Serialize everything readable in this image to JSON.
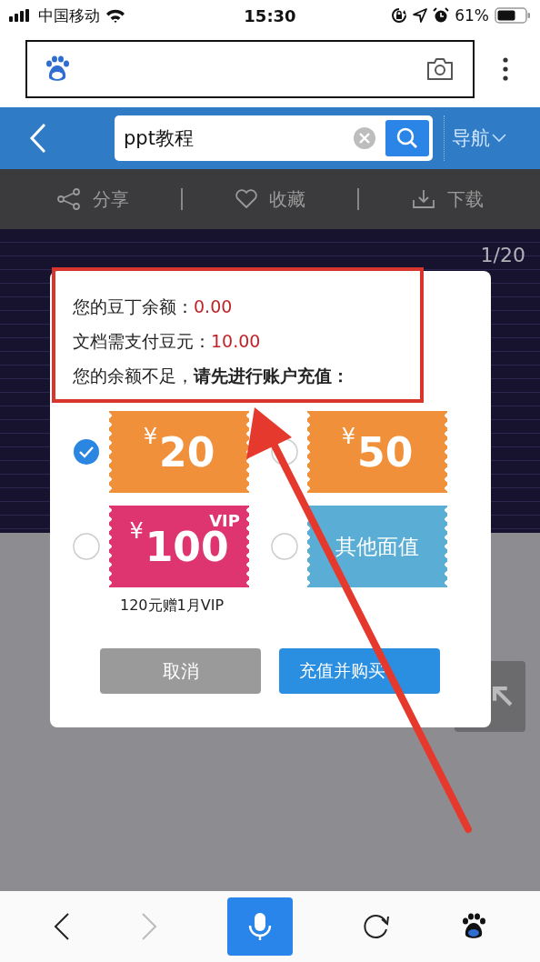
{
  "status_bar": {
    "carrier": "中国移动",
    "time": "15:30",
    "battery": "61%"
  },
  "search_bar": {
    "value": "ppt教程",
    "nav_label": "导航"
  },
  "toolbar": [
    {
      "kind": "share",
      "label": "分享"
    },
    {
      "kind": "favorite",
      "label": "收藏"
    },
    {
      "kind": "download",
      "label": "下载"
    }
  ],
  "document": {
    "page_counter": "1/20"
  },
  "dialog": {
    "balance_lines": [
      {
        "label": "您的豆丁余额：",
        "value": "0.00"
      },
      {
        "label": "文档需支付豆元：",
        "value": "10.00"
      }
    ],
    "notice": "您的余额不足，**请先进行账户充值：**",
    "options": [
      {
        "kind": "amount",
        "currency": "¥",
        "amount": "20",
        "color": "#f0903a",
        "selected": true
      },
      {
        "kind": "amount",
        "currency": "¥",
        "amount": "50",
        "color": "#f0903a",
        "selected": false
      },
      {
        "kind": "amount",
        "currency": "¥",
        "amount": "100",
        "badge": "VIP",
        "note": "120元赠1月VIP",
        "color": "#de3470",
        "selected": false
      },
      {
        "kind": "text",
        "label": "其他面值",
        "color": "#5aaed6",
        "selected": false
      }
    ],
    "buttons": [
      {
        "kind": "cancel",
        "label": "取消"
      },
      {
        "kind": "primary",
        "label": "充值并购买"
      }
    ]
  },
  "bottom_nav": [
    {
      "kind": "back",
      "disabled": false
    },
    {
      "kind": "forward",
      "disabled": true
    },
    {
      "kind": "voice",
      "disabled": false
    },
    {
      "kind": "refresh",
      "disabled": false
    },
    {
      "kind": "home",
      "disabled": false
    }
  ]
}
